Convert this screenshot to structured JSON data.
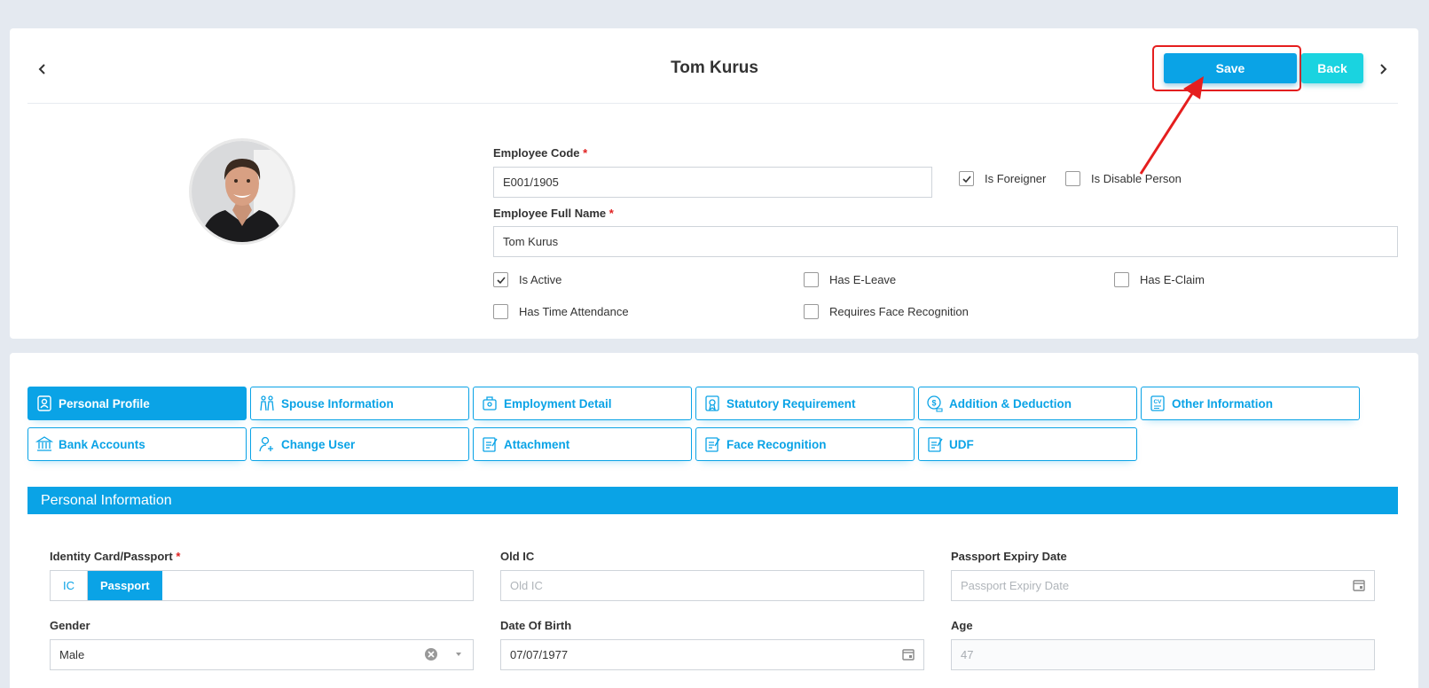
{
  "header": {
    "title": "Tom Kurus",
    "save_label": "Save",
    "back_label": "Back"
  },
  "employee": {
    "code_label": "Employee Code",
    "code_value": "E001/1905",
    "name_label": "Employee Full Name",
    "name_value": "Tom Kurus",
    "required_mark": "*"
  },
  "checkboxes": {
    "is_foreigner": {
      "label": "Is Foreigner",
      "checked": true
    },
    "is_disable_person": {
      "label": "Is Disable Person",
      "checked": false
    },
    "is_active": {
      "label": "Is Active",
      "checked": true
    },
    "has_e_leave": {
      "label": "Has E-Leave",
      "checked": false
    },
    "has_e_claim": {
      "label": "Has E-Claim",
      "checked": false
    },
    "has_time_attendance": {
      "label": "Has Time Attendance",
      "checked": false
    },
    "requires_face_recognition": {
      "label": "Requires Face Recognition",
      "checked": false
    }
  },
  "tabs": [
    {
      "label": "Personal Profile",
      "icon": "profile-icon",
      "active": true
    },
    {
      "label": "Spouse Information",
      "icon": "couple-icon",
      "active": false
    },
    {
      "label": "Employment Detail",
      "icon": "briefcase-icon",
      "active": false
    },
    {
      "label": "Statutory Requirement",
      "icon": "certificate-icon",
      "active": false
    },
    {
      "label": "Addition & Deduction",
      "icon": "money-icon",
      "active": false
    },
    {
      "label": "Other Information",
      "icon": "cv-icon",
      "active": false
    },
    {
      "label": "Bank Accounts",
      "icon": "bank-icon",
      "active": false
    },
    {
      "label": "Change User",
      "icon": "user-add-icon",
      "active": false
    },
    {
      "label": "Attachment",
      "icon": "document-edit-icon",
      "active": false
    },
    {
      "label": "Face Recognition",
      "icon": "document-edit-icon",
      "active": false
    },
    {
      "label": "UDF",
      "icon": "document-edit-icon",
      "active": false
    }
  ],
  "personal": {
    "section_title": "Personal Information",
    "id_label": "Identity Card/Passport",
    "id_options": [
      "IC",
      "Passport"
    ],
    "id_selected": "Passport",
    "old_ic_label": "Old IC",
    "old_ic_placeholder": "Old IC",
    "passport_expiry_label": "Passport Expiry Date",
    "passport_expiry_placeholder": "Passport Expiry Date",
    "gender_label": "Gender",
    "gender_value": "Male",
    "dob_label": "Date Of Birth",
    "dob_value": "07/07/1977",
    "age_label": "Age",
    "age_value": "47"
  }
}
